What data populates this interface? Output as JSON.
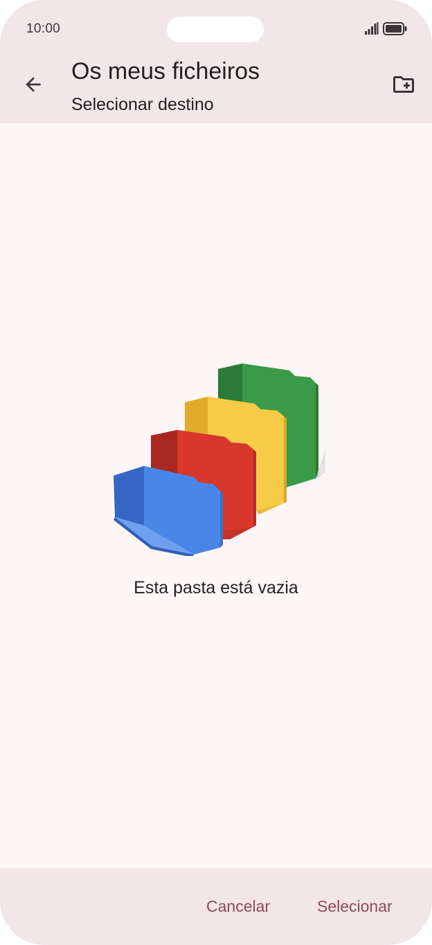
{
  "status_bar": {
    "time": "10:00",
    "signal_icon": "cellular-signal-icon",
    "battery_icon": "battery-full-icon"
  },
  "app_bar": {
    "back_icon": "arrow-back-icon",
    "title": "Os meus ficheiros",
    "subtitle": "Selecionar destino",
    "new_folder_icon": "create-new-folder-icon"
  },
  "content": {
    "illustration": "empty-folders-illustration",
    "empty_message": "Esta pasta está vazia"
  },
  "actions": {
    "cancel_label": "Cancelar",
    "select_label": "Selecionar"
  },
  "colors": {
    "bar_background": "#f3e6e8",
    "content_background": "#fcf6f6",
    "action_text": "#8b4a5e",
    "folder_green": "#3a9a48",
    "folder_yellow": "#f6cb45",
    "folder_red": "#d8372c",
    "folder_blue": "#4a86e8"
  }
}
